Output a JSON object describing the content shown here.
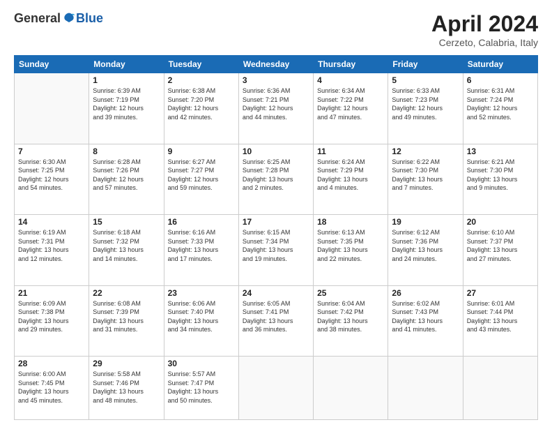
{
  "header": {
    "logo_general": "General",
    "logo_blue": "Blue",
    "title": "April 2024",
    "location": "Cerzeto, Calabria, Italy"
  },
  "weekdays": [
    "Sunday",
    "Monday",
    "Tuesday",
    "Wednesday",
    "Thursday",
    "Friday",
    "Saturday"
  ],
  "weeks": [
    [
      {
        "day": "",
        "info": ""
      },
      {
        "day": "1",
        "info": "Sunrise: 6:39 AM\nSunset: 7:19 PM\nDaylight: 12 hours\nand 39 minutes."
      },
      {
        "day": "2",
        "info": "Sunrise: 6:38 AM\nSunset: 7:20 PM\nDaylight: 12 hours\nand 42 minutes."
      },
      {
        "day": "3",
        "info": "Sunrise: 6:36 AM\nSunset: 7:21 PM\nDaylight: 12 hours\nand 44 minutes."
      },
      {
        "day": "4",
        "info": "Sunrise: 6:34 AM\nSunset: 7:22 PM\nDaylight: 12 hours\nand 47 minutes."
      },
      {
        "day": "5",
        "info": "Sunrise: 6:33 AM\nSunset: 7:23 PM\nDaylight: 12 hours\nand 49 minutes."
      },
      {
        "day": "6",
        "info": "Sunrise: 6:31 AM\nSunset: 7:24 PM\nDaylight: 12 hours\nand 52 minutes."
      }
    ],
    [
      {
        "day": "7",
        "info": "Sunrise: 6:30 AM\nSunset: 7:25 PM\nDaylight: 12 hours\nand 54 minutes."
      },
      {
        "day": "8",
        "info": "Sunrise: 6:28 AM\nSunset: 7:26 PM\nDaylight: 12 hours\nand 57 minutes."
      },
      {
        "day": "9",
        "info": "Sunrise: 6:27 AM\nSunset: 7:27 PM\nDaylight: 12 hours\nand 59 minutes."
      },
      {
        "day": "10",
        "info": "Sunrise: 6:25 AM\nSunset: 7:28 PM\nDaylight: 13 hours\nand 2 minutes."
      },
      {
        "day": "11",
        "info": "Sunrise: 6:24 AM\nSunset: 7:29 PM\nDaylight: 13 hours\nand 4 minutes."
      },
      {
        "day": "12",
        "info": "Sunrise: 6:22 AM\nSunset: 7:30 PM\nDaylight: 13 hours\nand 7 minutes."
      },
      {
        "day": "13",
        "info": "Sunrise: 6:21 AM\nSunset: 7:30 PM\nDaylight: 13 hours\nand 9 minutes."
      }
    ],
    [
      {
        "day": "14",
        "info": "Sunrise: 6:19 AM\nSunset: 7:31 PM\nDaylight: 13 hours\nand 12 minutes."
      },
      {
        "day": "15",
        "info": "Sunrise: 6:18 AM\nSunset: 7:32 PM\nDaylight: 13 hours\nand 14 minutes."
      },
      {
        "day": "16",
        "info": "Sunrise: 6:16 AM\nSunset: 7:33 PM\nDaylight: 13 hours\nand 17 minutes."
      },
      {
        "day": "17",
        "info": "Sunrise: 6:15 AM\nSunset: 7:34 PM\nDaylight: 13 hours\nand 19 minutes."
      },
      {
        "day": "18",
        "info": "Sunrise: 6:13 AM\nSunset: 7:35 PM\nDaylight: 13 hours\nand 22 minutes."
      },
      {
        "day": "19",
        "info": "Sunrise: 6:12 AM\nSunset: 7:36 PM\nDaylight: 13 hours\nand 24 minutes."
      },
      {
        "day": "20",
        "info": "Sunrise: 6:10 AM\nSunset: 7:37 PM\nDaylight: 13 hours\nand 27 minutes."
      }
    ],
    [
      {
        "day": "21",
        "info": "Sunrise: 6:09 AM\nSunset: 7:38 PM\nDaylight: 13 hours\nand 29 minutes."
      },
      {
        "day": "22",
        "info": "Sunrise: 6:08 AM\nSunset: 7:39 PM\nDaylight: 13 hours\nand 31 minutes."
      },
      {
        "day": "23",
        "info": "Sunrise: 6:06 AM\nSunset: 7:40 PM\nDaylight: 13 hours\nand 34 minutes."
      },
      {
        "day": "24",
        "info": "Sunrise: 6:05 AM\nSunset: 7:41 PM\nDaylight: 13 hours\nand 36 minutes."
      },
      {
        "day": "25",
        "info": "Sunrise: 6:04 AM\nSunset: 7:42 PM\nDaylight: 13 hours\nand 38 minutes."
      },
      {
        "day": "26",
        "info": "Sunrise: 6:02 AM\nSunset: 7:43 PM\nDaylight: 13 hours\nand 41 minutes."
      },
      {
        "day": "27",
        "info": "Sunrise: 6:01 AM\nSunset: 7:44 PM\nDaylight: 13 hours\nand 43 minutes."
      }
    ],
    [
      {
        "day": "28",
        "info": "Sunrise: 6:00 AM\nSunset: 7:45 PM\nDaylight: 13 hours\nand 45 minutes."
      },
      {
        "day": "29",
        "info": "Sunrise: 5:58 AM\nSunset: 7:46 PM\nDaylight: 13 hours\nand 48 minutes."
      },
      {
        "day": "30",
        "info": "Sunrise: 5:57 AM\nSunset: 7:47 PM\nDaylight: 13 hours\nand 50 minutes."
      },
      {
        "day": "",
        "info": ""
      },
      {
        "day": "",
        "info": ""
      },
      {
        "day": "",
        "info": ""
      },
      {
        "day": "",
        "info": ""
      }
    ]
  ]
}
